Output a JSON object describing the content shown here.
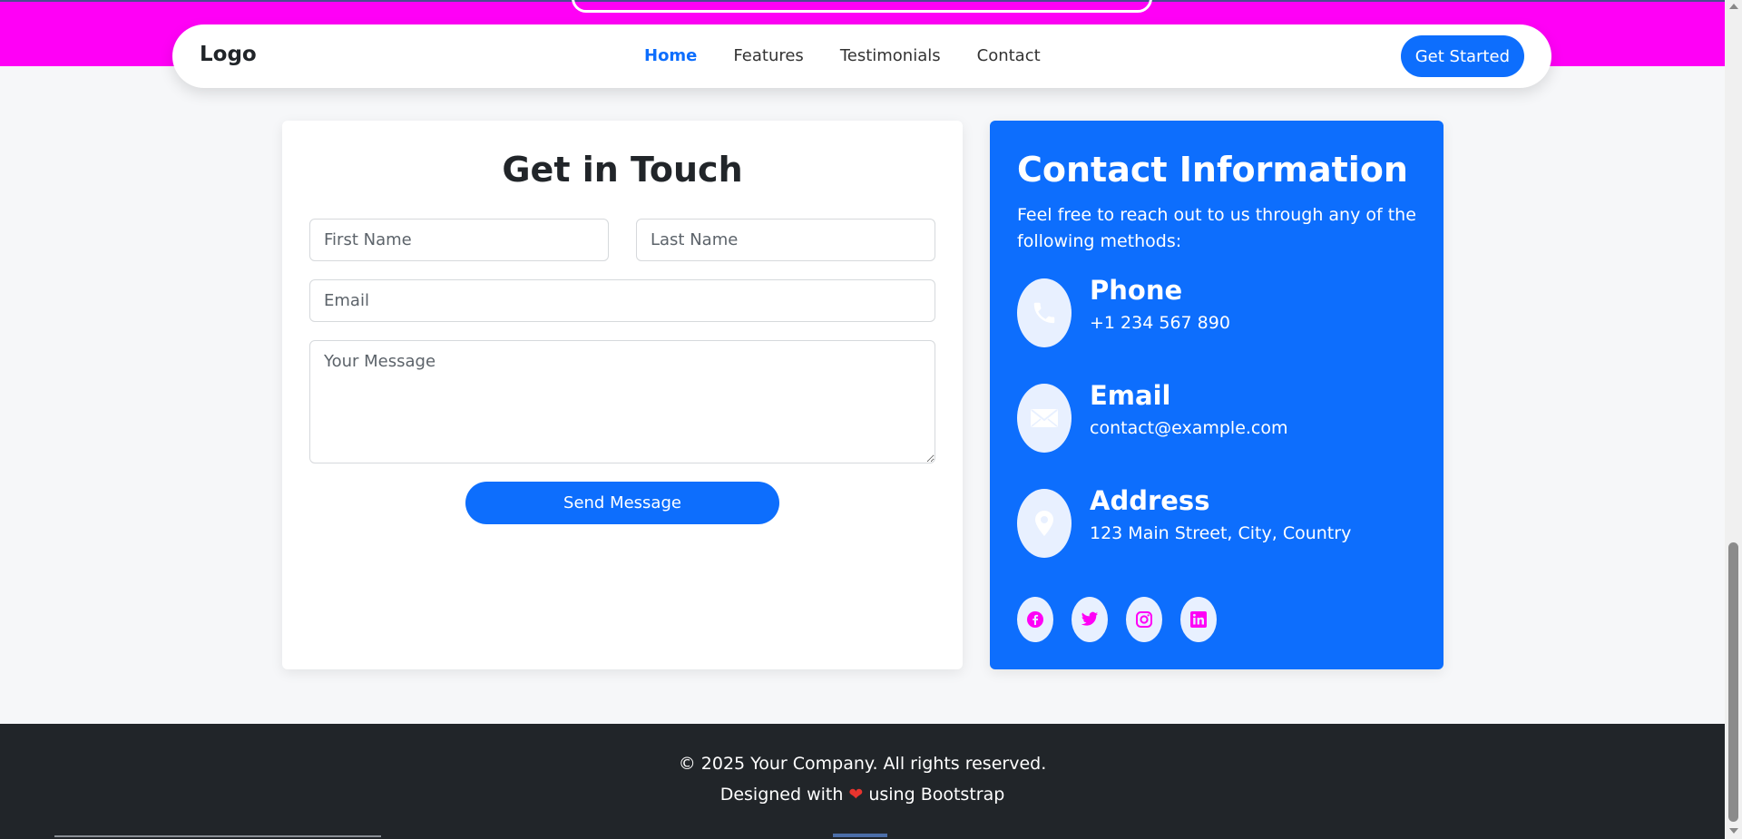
{
  "colors": {
    "primary": "#0d6efd",
    "magenta": "#ff00f6",
    "footer_bg": "#212529",
    "icon_bg": "#e8f0ff"
  },
  "navbar": {
    "logo": "Logo",
    "links": [
      {
        "label": "Home",
        "active": true
      },
      {
        "label": "Features",
        "active": false
      },
      {
        "label": "Testimonials",
        "active": false
      },
      {
        "label": "Contact",
        "active": false
      }
    ],
    "cta_label": "Get Started"
  },
  "form": {
    "title": "Get in Touch",
    "first_name_placeholder": "First Name",
    "last_name_placeholder": "Last Name",
    "email_placeholder": "Email",
    "message_placeholder": "Your Message",
    "submit_label": "Send Message"
  },
  "contact_info": {
    "title": "Contact Information",
    "description": "Feel free to reach out to us through any of the following methods:",
    "items": [
      {
        "icon": "phone-icon",
        "heading": "Phone",
        "value": "+1 234 567 890"
      },
      {
        "icon": "envelope-icon",
        "heading": "Email",
        "value": "contact@example.com"
      },
      {
        "icon": "map-pin-icon",
        "heading": "Address",
        "value": "123 Main Street, City, Country"
      }
    ],
    "socials": [
      "facebook-icon",
      "twitter-icon",
      "instagram-icon",
      "linkedin-icon"
    ]
  },
  "footer": {
    "copyright": "© 2025 Your Company. All rights reserved.",
    "designed_prefix": "Designed with",
    "designed_suffix": "using Bootstrap"
  }
}
